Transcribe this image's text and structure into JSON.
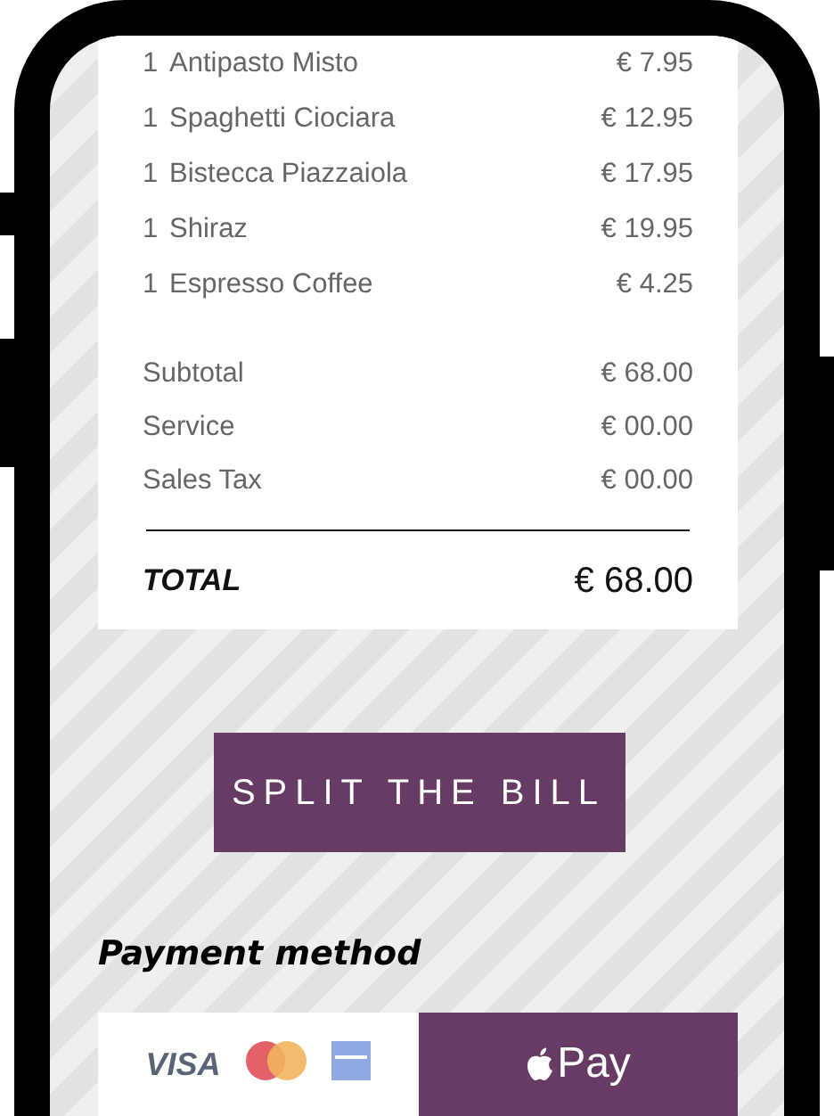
{
  "order_items": [
    {
      "qty": "1",
      "name": "Antipasto Misto",
      "price": "€ 7.95"
    },
    {
      "qty": "1",
      "name": "Spaghetti Ciociara",
      "price": "€ 12.95"
    },
    {
      "qty": "1",
      "name": "Bistecca Piazzaiola",
      "price": "€ 17.95"
    },
    {
      "qty": "1",
      "name": "Shiraz",
      "price": "€ 19.95"
    },
    {
      "qty": "1",
      "name": "Espresso Coffee",
      "price": "€ 4.25"
    }
  ],
  "summary": [
    {
      "label": "Subtotal",
      "amount": "€ 68.00"
    },
    {
      "label": "Service",
      "amount": "€ 00.00"
    },
    {
      "label": "Sales Tax",
      "amount": "€ 00.00"
    }
  ],
  "total": {
    "label": "TOTAL",
    "amount": "€ 68.00"
  },
  "split_button": "SPLIT THE BILL",
  "payment_heading": "Payment method",
  "payment_options": [
    {
      "kind": "cards",
      "label": "VISA",
      "selected": false
    },
    {
      "kind": "apple_pay",
      "label": "Pay",
      "selected": true
    }
  ]
}
